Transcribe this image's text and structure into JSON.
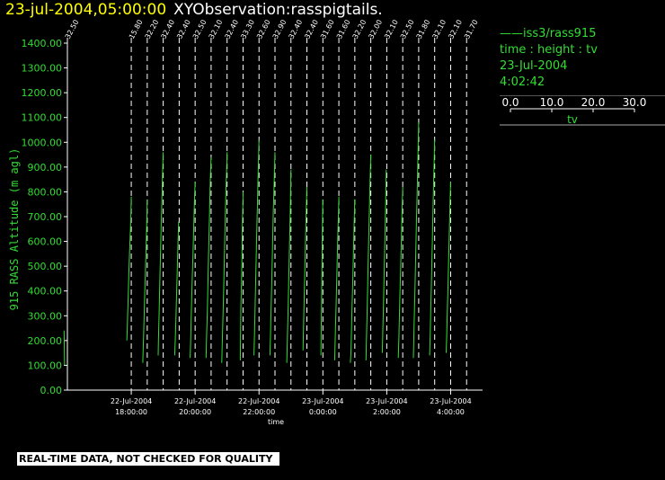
{
  "header": {
    "time": "23-jul-2004,05:00:00",
    "observation": "XYObservation:rasspigtails."
  },
  "legend": {
    "series": "iss3/rass915",
    "line_marker": "——",
    "variable": "time : height : tv",
    "date": "23-Jul-2004",
    "clock": "4:02:42",
    "scale_ticks": [
      "0.0",
      "10.0",
      "20.0",
      "30.0"
    ],
    "scale_label": "tv"
  },
  "disclaimer": "REAL-TIME DATA, NOT CHECKED FOR QUALITY",
  "colors": {
    "title_time": "#ffff00",
    "title_text": "#ffffff",
    "series": "#33dd33",
    "grid": "#ffffff",
    "background": "#000000"
  },
  "chart_data": {
    "type": "line",
    "title": "",
    "ylabel": "915 RASS Altitude (m agl)",
    "xlabel": "time",
    "ylim": [
      0,
      1400
    ],
    "yticks": [
      "0.00",
      "100.00",
      "200.00",
      "300.00",
      "400.00",
      "500.00",
      "600.00",
      "700.00",
      "800.00",
      "900.00",
      "1000.00",
      "1100.00",
      "1200.00",
      "1300.00",
      "1400.00"
    ],
    "x_range_hours": [
      "22-Jul-2004 16:00:00",
      "23-Jul-2004 05:00:00"
    ],
    "xticks": [
      {
        "date": "22-Jul-2004",
        "time": "18:00:00"
      },
      {
        "date": "22-Jul-2004",
        "time": "20:00:00"
      },
      {
        "date": "22-Jul-2004",
        "time": "22:00:00"
      },
      {
        "date": "23-Jul-2004",
        "time": "0:00:00"
      },
      {
        "date": "23-Jul-2004",
        "time": "2:00:00"
      },
      {
        "date": "23-Jul-2004",
        "time": "4:00:00"
      }
    ],
    "profile_scale": "tv 0.0–30.0 per profile width",
    "grid": "dashed vertical lines at each profile time",
    "profiles": [
      {
        "time": "22-Jul-2004 16:00",
        "label": "32.50",
        "points": [
          [
            25.0,
            100
          ],
          [
            24.0,
            240
          ]
        ]
      },
      {
        "time": "22-Jul-2004 18:00",
        "label": "15.80",
        "points": [
          [
            30.0,
            780
          ],
          [
            29.0,
            680
          ],
          [
            27.0,
            560
          ],
          [
            25.5,
            460
          ],
          [
            24.5,
            380
          ],
          [
            23.5,
            300
          ],
          [
            22.8,
            240
          ],
          [
            22.0,
            200
          ]
        ]
      },
      {
        "time": "22-Jul-2004 18:30",
        "label": "32.20",
        "points": [
          [
            30.0,
            770
          ],
          [
            29.5,
            700
          ],
          [
            28.5,
            620
          ],
          [
            27.5,
            540
          ],
          [
            26.5,
            460
          ],
          [
            25.5,
            380
          ],
          [
            24.5,
            300
          ],
          [
            23.5,
            220
          ],
          [
            22.5,
            150
          ],
          [
            22.0,
            110
          ]
        ]
      },
      {
        "time": "22-Jul-2004 19:00",
        "label": "32.40",
        "points": [
          [
            30.0,
            960
          ],
          [
            28.5,
            850
          ],
          [
            27.5,
            760
          ],
          [
            26.5,
            670
          ],
          [
            25.5,
            580
          ],
          [
            24.5,
            490
          ],
          [
            23.5,
            400
          ],
          [
            22.5,
            300
          ],
          [
            21.5,
            200
          ],
          [
            21.0,
            140
          ]
        ]
      },
      {
        "time": "22-Jul-2004 19:30",
        "label": "32.40",
        "points": [
          [
            29.0,
            680
          ],
          [
            28.0,
            600
          ],
          [
            27.0,
            520
          ],
          [
            26.0,
            440
          ],
          [
            25.0,
            360
          ],
          [
            24.0,
            280
          ],
          [
            23.0,
            200
          ],
          [
            22.0,
            140
          ]
        ]
      },
      {
        "time": "22-Jul-2004 20:00",
        "label": "32.50",
        "points": [
          [
            30.0,
            840
          ],
          [
            29.0,
            780
          ],
          [
            28.0,
            700
          ],
          [
            27.0,
            620
          ],
          [
            26.0,
            540
          ],
          [
            25.0,
            460
          ],
          [
            24.0,
            380
          ],
          [
            23.0,
            300
          ],
          [
            22.0,
            200
          ],
          [
            21.0,
            130
          ]
        ]
      },
      {
        "time": "22-Jul-2004 20:30",
        "label": "32.10",
        "points": [
          [
            30.0,
            940
          ],
          [
            29.0,
            880
          ],
          [
            28.0,
            800
          ],
          [
            27.0,
            700
          ],
          [
            26.0,
            600
          ],
          [
            25.0,
            500
          ],
          [
            24.0,
            400
          ],
          [
            23.0,
            300
          ],
          [
            22.0,
            220
          ],
          [
            21.0,
            130
          ]
        ]
      },
      {
        "time": "22-Jul-2004 21:00",
        "label": "32.40",
        "points": [
          [
            30.0,
            960
          ],
          [
            29.0,
            880
          ],
          [
            28.0,
            800
          ],
          [
            27.0,
            720
          ],
          [
            26.0,
            620
          ],
          [
            25.0,
            520
          ],
          [
            24.0,
            420
          ],
          [
            23.0,
            320
          ],
          [
            22.0,
            240
          ],
          [
            21.0,
            160
          ],
          [
            20.5,
            110
          ]
        ]
      },
      {
        "time": "22-Jul-2004 21:30",
        "label": "33.30",
        "points": [
          [
            30.0,
            800
          ],
          [
            29.5,
            740
          ],
          [
            29.0,
            680
          ],
          [
            28.5,
            600
          ],
          [
            28.0,
            520
          ],
          [
            27.0,
            420
          ],
          [
            26.0,
            320
          ],
          [
            25.5,
            220
          ],
          [
            25.0,
            120
          ]
        ]
      },
      {
        "time": "22-Jul-2004 22:00",
        "label": "32.60",
        "points": [
          [
            30.0,
            1010
          ],
          [
            29.0,
            920
          ],
          [
            28.0,
            840
          ],
          [
            27.0,
            740
          ],
          [
            26.0,
            640
          ],
          [
            25.0,
            540
          ],
          [
            24.0,
            440
          ],
          [
            23.0,
            340
          ],
          [
            22.0,
            240
          ],
          [
            21.0,
            140
          ]
        ]
      },
      {
        "time": "22-Jul-2004 22:30",
        "label": "32.90",
        "points": [
          [
            30.0,
            960
          ],
          [
            29.0,
            880
          ],
          [
            28.0,
            800
          ],
          [
            27.0,
            720
          ],
          [
            26.0,
            620
          ],
          [
            25.0,
            520
          ],
          [
            24.0,
            420
          ],
          [
            23.0,
            320
          ],
          [
            22.0,
            220
          ],
          [
            21.0,
            140
          ]
        ]
      },
      {
        "time": "22-Jul-2004 23:00",
        "label": "32.40",
        "points": [
          [
            30.0,
            890
          ],
          [
            29.5,
            820
          ],
          [
            29.0,
            740
          ],
          [
            28.0,
            640
          ],
          [
            27.0,
            540
          ],
          [
            26.0,
            440
          ],
          [
            25.0,
            340
          ],
          [
            24.0,
            240
          ],
          [
            23.0,
            150
          ],
          [
            22.5,
            110
          ]
        ]
      },
      {
        "time": "22-Jul-2004 23:30",
        "label": "32.40",
        "points": [
          [
            30.0,
            820
          ],
          [
            29.0,
            740
          ],
          [
            28.0,
            660
          ],
          [
            27.0,
            560
          ],
          [
            26.0,
            460
          ],
          [
            25.0,
            360
          ],
          [
            24.0,
            260
          ],
          [
            23.0,
            160
          ]
        ]
      },
      {
        "time": "23-Jul-2004 0:00",
        "label": "31.60",
        "points": [
          [
            30.0,
            770
          ],
          [
            29.5,
            720
          ],
          [
            29.0,
            640
          ],
          [
            28.5,
            540
          ],
          [
            28.0,
            440
          ],
          [
            27.5,
            340
          ],
          [
            27.0,
            240
          ],
          [
            26.5,
            140
          ]
        ]
      },
      {
        "time": "23-Jul-2004 0:30",
        "label": "31.60",
        "points": [
          [
            30.0,
            780
          ],
          [
            29.0,
            700
          ],
          [
            28.0,
            610
          ],
          [
            27.0,
            520
          ],
          [
            26.0,
            430
          ],
          [
            25.0,
            340
          ],
          [
            24.0,
            250
          ],
          [
            23.0,
            160
          ],
          [
            22.5,
            120
          ]
        ]
      },
      {
        "time": "23-Jul-2004 1:00",
        "label": "32.20",
        "points": [
          [
            30.0,
            770
          ],
          [
            29.0,
            690
          ],
          [
            28.0,
            600
          ],
          [
            27.0,
            510
          ],
          [
            26.0,
            420
          ],
          [
            25.0,
            330
          ],
          [
            24.0,
            240
          ],
          [
            23.0,
            150
          ],
          [
            22.0,
            110
          ]
        ]
      },
      {
        "time": "23-Jul-2004 1:30",
        "label": "32.00",
        "points": [
          [
            30.0,
            950
          ],
          [
            29.0,
            870
          ],
          [
            28.0,
            780
          ],
          [
            27.0,
            680
          ],
          [
            26.0,
            580
          ],
          [
            25.0,
            480
          ],
          [
            24.0,
            380
          ],
          [
            23.0,
            280
          ],
          [
            22.0,
            180
          ],
          [
            21.5,
            120
          ]
        ]
      },
      {
        "time": "23-Jul-2004 2:00",
        "label": "32.10",
        "points": [
          [
            29.0,
            890
          ],
          [
            28.5,
            820
          ],
          [
            28.0,
            740
          ],
          [
            27.0,
            640
          ],
          [
            26.0,
            540
          ],
          [
            25.0,
            440
          ],
          [
            24.0,
            340
          ],
          [
            23.0,
            240
          ],
          [
            22.0,
            150
          ]
        ]
      },
      {
        "time": "23-Jul-2004 2:30",
        "label": "32.50",
        "points": [
          [
            30.0,
            820
          ],
          [
            29.0,
            740
          ],
          [
            28.0,
            650
          ],
          [
            27.0,
            560
          ],
          [
            26.0,
            470
          ],
          [
            25.0,
            380
          ],
          [
            24.0,
            290
          ],
          [
            23.0,
            200
          ],
          [
            22.0,
            130
          ]
        ]
      },
      {
        "time": "23-Jul-2004 3:00",
        "label": "31.80",
        "points": [
          [
            30.0,
            1080
          ],
          [
            29.0,
            980
          ],
          [
            28.0,
            880
          ],
          [
            27.0,
            780
          ],
          [
            26.0,
            680
          ],
          [
            25.0,
            580
          ],
          [
            24.0,
            480
          ],
          [
            23.0,
            380
          ],
          [
            22.0,
            280
          ],
          [
            21.0,
            180
          ],
          [
            20.5,
            130
          ]
        ]
      },
      {
        "time": "23-Jul-2004 3:30",
        "label": "32.10",
        "points": [
          [
            30.0,
            1010
          ],
          [
            29.0,
            920
          ],
          [
            28.0,
            820
          ],
          [
            27.0,
            720
          ],
          [
            26.0,
            620
          ],
          [
            25.0,
            520
          ],
          [
            24.0,
            420
          ],
          [
            23.0,
            320
          ],
          [
            22.0,
            220
          ],
          [
            21.0,
            140
          ]
        ]
      },
      {
        "time": "23-Jul-2004 4:00",
        "label": "32.10",
        "points": [
          [
            30.0,
            840
          ],
          [
            29.0,
            760
          ],
          [
            28.0,
            670
          ],
          [
            27.0,
            580
          ],
          [
            26.0,
            490
          ],
          [
            25.0,
            400
          ],
          [
            24.0,
            310
          ],
          [
            23.0,
            220
          ],
          [
            22.0,
            150
          ]
        ]
      },
      {
        "time": "23-Jul-2004 4:30",
        "label": "31.70",
        "points": []
      }
    ]
  }
}
